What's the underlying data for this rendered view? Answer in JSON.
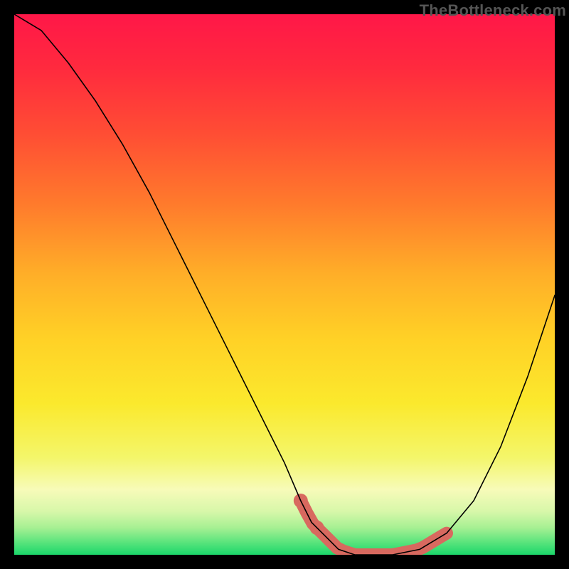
{
  "attribution": "TheBottleneck.com",
  "gradient": {
    "stops": [
      {
        "offset": 0.0,
        "color": "#ff1748"
      },
      {
        "offset": 0.1,
        "color": "#ff2a3e"
      },
      {
        "offset": 0.22,
        "color": "#ff4d34"
      },
      {
        "offset": 0.35,
        "color": "#ff7a2c"
      },
      {
        "offset": 0.48,
        "color": "#ffae28"
      },
      {
        "offset": 0.6,
        "color": "#ffd126"
      },
      {
        "offset": 0.72,
        "color": "#fbe92d"
      },
      {
        "offset": 0.82,
        "color": "#f4f66a"
      },
      {
        "offset": 0.88,
        "color": "#f7fbb9"
      },
      {
        "offset": 0.92,
        "color": "#d7f7a9"
      },
      {
        "offset": 0.95,
        "color": "#a6f093"
      },
      {
        "offset": 0.975,
        "color": "#5fe57e"
      },
      {
        "offset": 1.0,
        "color": "#1bd76b"
      }
    ]
  },
  "chart_data": {
    "type": "line",
    "title": "",
    "xlabel": "",
    "ylabel": "",
    "xlim": [
      0,
      100
    ],
    "ylim": [
      0,
      100
    ],
    "series": [
      {
        "name": "bottleneck-curve",
        "x": [
          0,
          5,
          10,
          15,
          20,
          25,
          30,
          35,
          40,
          45,
          50,
          53,
          55,
          58,
          60,
          63,
          65,
          70,
          75,
          80,
          85,
          90,
          95,
          100
        ],
        "y": [
          100,
          97,
          91,
          84,
          76,
          67,
          57,
          47,
          37,
          27,
          17,
          10,
          6,
          3,
          1,
          0,
          0,
          0,
          1,
          4,
          10,
          20,
          33,
          48
        ]
      }
    ],
    "optimal_range": {
      "x_start": 53,
      "x_end": 80,
      "dots_x": [
        53,
        56
      ],
      "comment": "salmon-highlighted low-bottleneck region near the valley floor"
    }
  }
}
